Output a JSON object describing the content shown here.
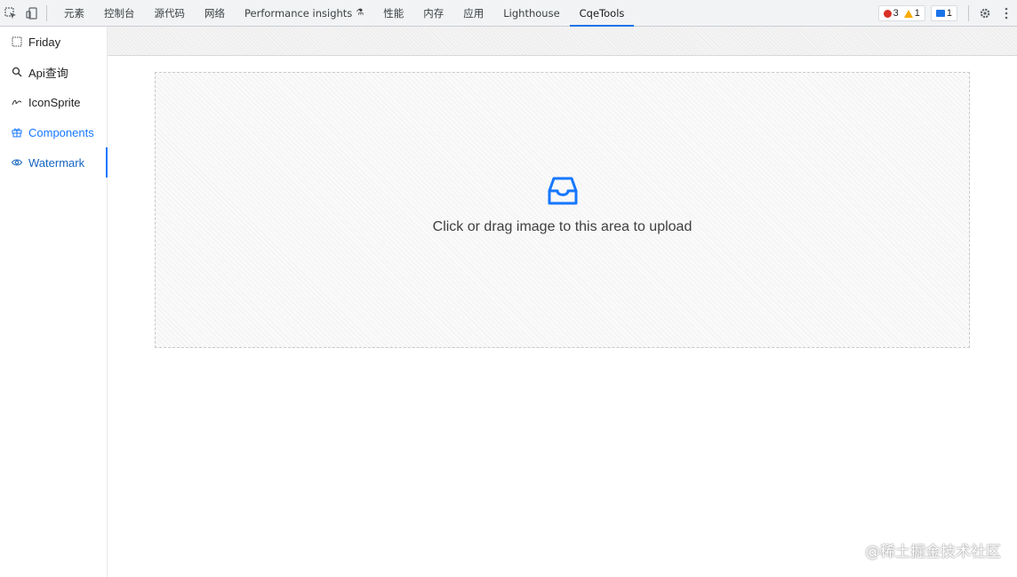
{
  "devtools": {
    "tabs": [
      {
        "label": "元素"
      },
      {
        "label": "控制台"
      },
      {
        "label": "源代码"
      },
      {
        "label": "网络"
      },
      {
        "label": "Performance insights",
        "icon": "flask-icon"
      },
      {
        "label": "性能"
      },
      {
        "label": "内存"
      },
      {
        "label": "应用"
      },
      {
        "label": "Lighthouse"
      },
      {
        "label": "CqeTools",
        "active": true
      }
    ],
    "status": {
      "errors": "3",
      "warnings": "1",
      "messages": "1"
    }
  },
  "sidebar": {
    "items": [
      {
        "label": "Friday",
        "icon": "grid-icon"
      },
      {
        "label": "Api查询",
        "icon": "search-icon"
      },
      {
        "label": "IconSprite",
        "icon": "signature-icon"
      },
      {
        "label": "Components",
        "icon": "gift-icon",
        "color": "#1677ff"
      },
      {
        "label": "Watermark",
        "icon": "eye-icon",
        "selected": true
      }
    ]
  },
  "upload": {
    "hint": "Click or drag image to this area to upload",
    "icon": "inbox-icon",
    "accent": "#1677ff"
  },
  "watermark": {
    "text": "@稀土掘金技术社区"
  }
}
